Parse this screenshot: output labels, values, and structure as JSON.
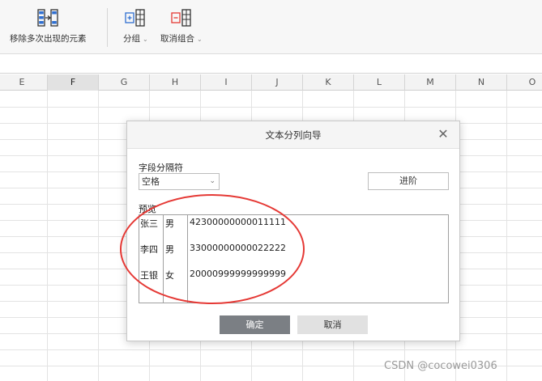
{
  "ribbon": {
    "remove_dup_label": "移除多次出现的元素",
    "group_label": "分组",
    "ungroup_label": "取消组合",
    "caret": "⌄",
    "colors": {
      "accent_blue": "#2f6fd1",
      "accent_red": "#e53935"
    }
  },
  "grid": {
    "columns": [
      {
        "letter": "E",
        "selected": false
      },
      {
        "letter": "F",
        "selected": true
      },
      {
        "letter": "G",
        "selected": false
      },
      {
        "letter": "H",
        "selected": false
      },
      {
        "letter": "I",
        "selected": false
      },
      {
        "letter": "J",
        "selected": false
      },
      {
        "letter": "K",
        "selected": false
      },
      {
        "letter": "L",
        "selected": false
      },
      {
        "letter": "M",
        "selected": false
      },
      {
        "letter": "N",
        "selected": false
      },
      {
        "letter": "O",
        "selected": false
      }
    ]
  },
  "dialog": {
    "title": "文本分列向导",
    "close_glyph": "✕",
    "separator_label": "字段分隔符",
    "separator_value": "空格",
    "select_chevron": "⌄",
    "advanced_label": "进阶",
    "preview_label": "预览",
    "preview_rows": [
      {
        "name": "张三",
        "gender": "男",
        "id": "42300000000011111"
      },
      {
        "name": "李四",
        "gender": "男",
        "id": "33000000000022222"
      },
      {
        "name": "王银",
        "gender": "女",
        "id": "20000999999999999"
      }
    ],
    "ok_label": "确定",
    "cancel_label": "取消"
  },
  "watermark": "CSDN @cocowei0306"
}
